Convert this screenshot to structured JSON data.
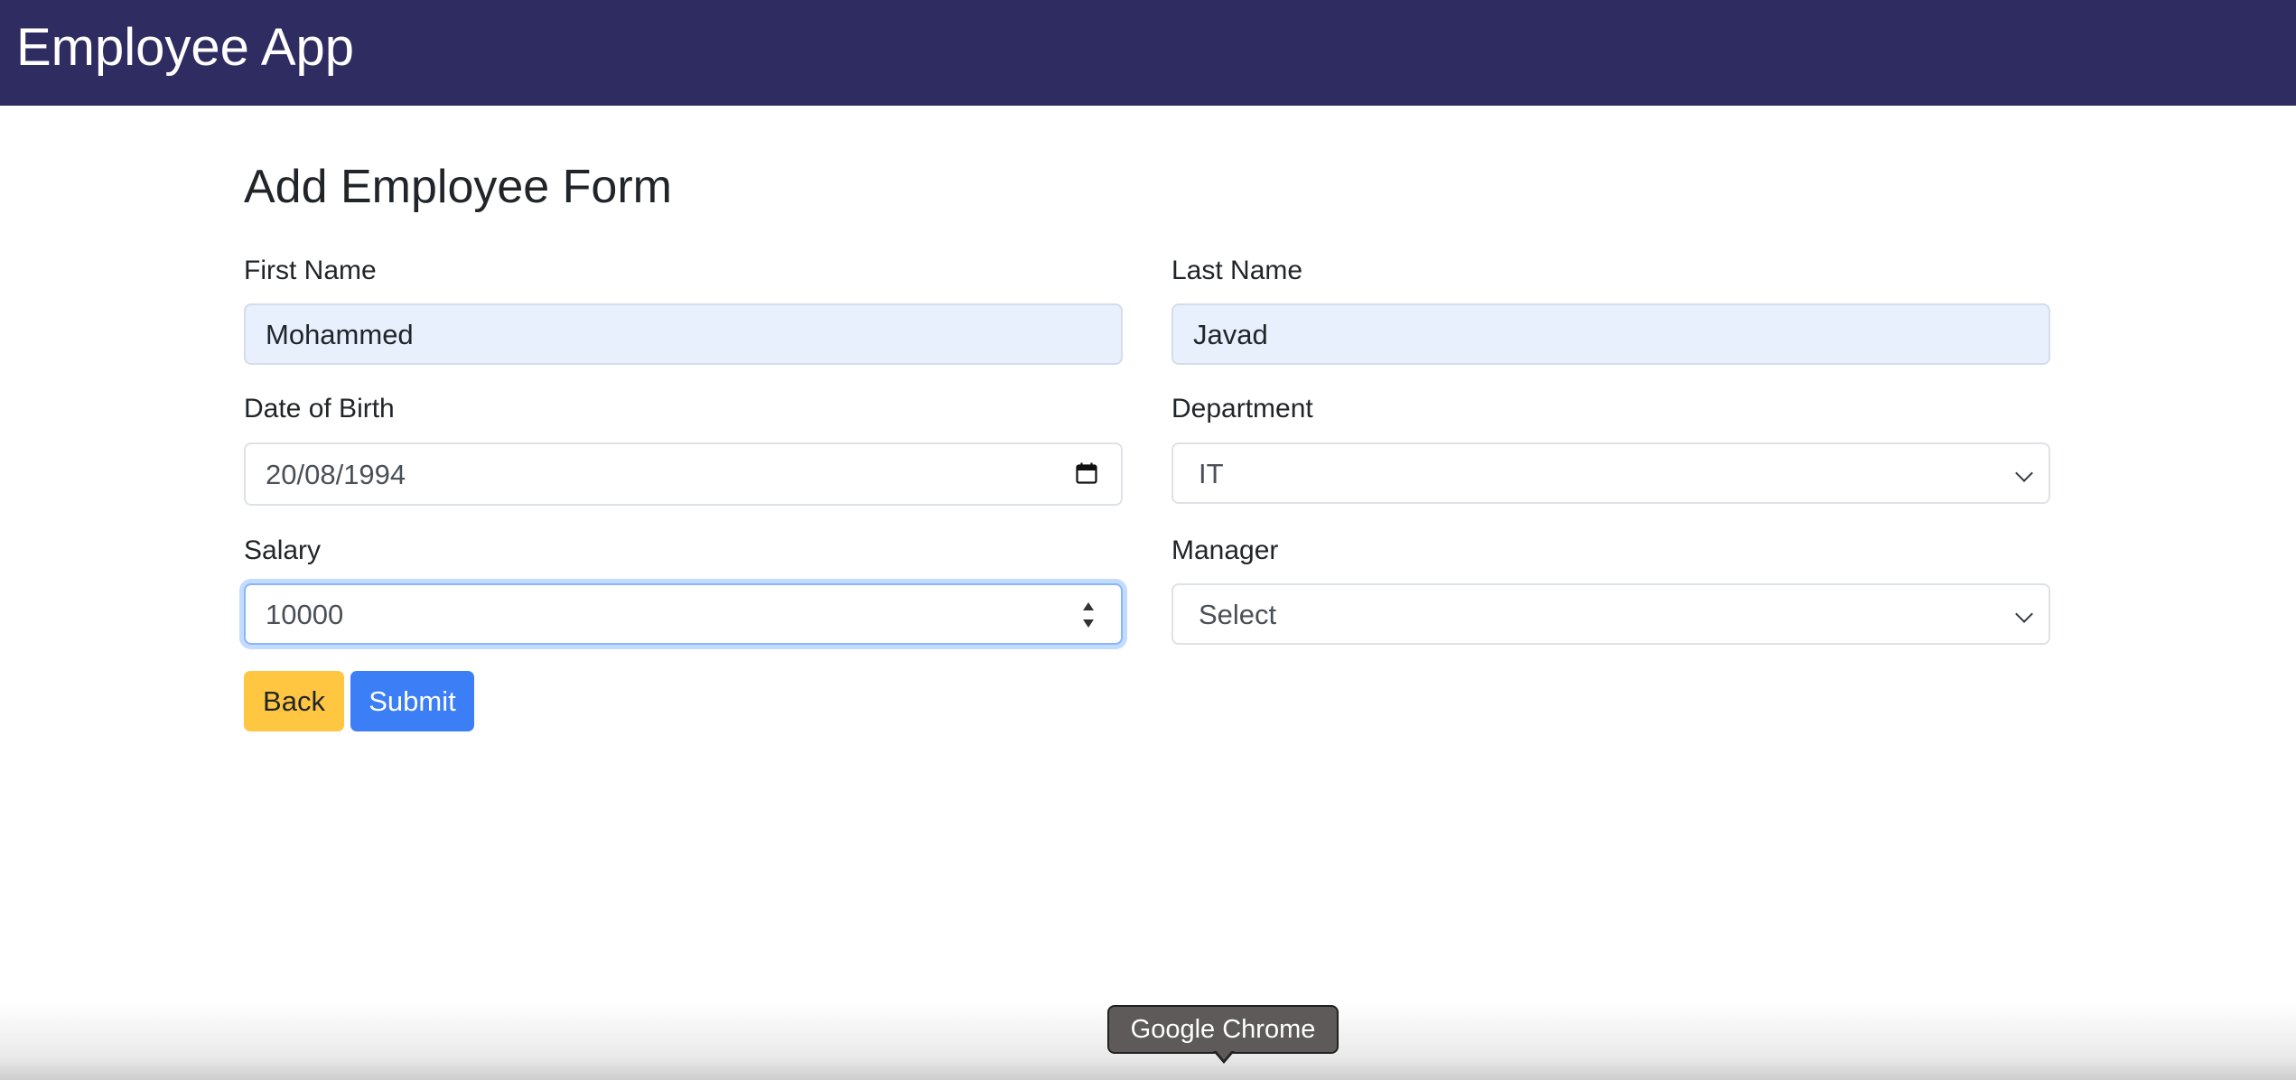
{
  "app": {
    "brand": "Employee App"
  },
  "form": {
    "title": "Add Employee Form",
    "first_name": {
      "label": "First Name",
      "value": "Mohammed"
    },
    "last_name": {
      "label": "Last Name",
      "value": "Javad"
    },
    "date_of_birth": {
      "label": "Date of Birth",
      "value": "20/08/1994"
    },
    "department": {
      "label": "Department",
      "selected": "IT"
    },
    "salary": {
      "label": "Salary",
      "value": "10000"
    },
    "manager": {
      "label": "Manager",
      "selected": "Select"
    }
  },
  "buttons": {
    "back": "Back",
    "submit": "Submit"
  },
  "tooltip": {
    "text": "Google Chrome"
  },
  "colors": {
    "navbar": "#2e2c60",
    "back_button": "#ffc641",
    "submit_button": "#3b7ef5",
    "autofill": "#e8f0fe",
    "focus_ring": "#86b7fe"
  }
}
